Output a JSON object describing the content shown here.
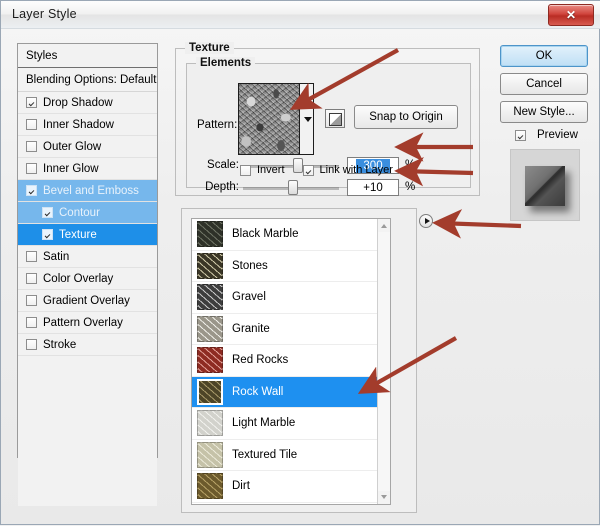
{
  "window": {
    "title": "Layer Style",
    "close_label": "✕"
  },
  "styles_panel": {
    "header": "Styles",
    "blending_options": "Blending Options: Default",
    "items": [
      {
        "label": "Drop Shadow",
        "checked": true,
        "selected": "none",
        "indent": false
      },
      {
        "label": "Inner Shadow",
        "checked": false,
        "selected": "none",
        "indent": false
      },
      {
        "label": "Outer Glow",
        "checked": false,
        "selected": "none",
        "indent": false
      },
      {
        "label": "Inner Glow",
        "checked": false,
        "selected": "none",
        "indent": false
      },
      {
        "label": "Bevel and Emboss",
        "checked": true,
        "selected": "soft",
        "indent": false
      },
      {
        "label": "Contour",
        "checked": true,
        "selected": "soft",
        "indent": true
      },
      {
        "label": "Texture",
        "checked": true,
        "selected": "strong",
        "indent": true
      },
      {
        "label": "Satin",
        "checked": false,
        "selected": "none",
        "indent": false
      },
      {
        "label": "Color Overlay",
        "checked": false,
        "selected": "none",
        "indent": false
      },
      {
        "label": "Gradient Overlay",
        "checked": false,
        "selected": "none",
        "indent": false
      },
      {
        "label": "Pattern Overlay",
        "checked": false,
        "selected": "none",
        "indent": false
      },
      {
        "label": "Stroke",
        "checked": false,
        "selected": "none",
        "indent": false
      }
    ]
  },
  "texture": {
    "group_title": "Texture",
    "elements_title": "Elements",
    "pattern_label": "Pattern:",
    "snap_to_origin_label": "Snap to Origin",
    "scale_label": "Scale:",
    "scale_value": "300",
    "scale_unit": "%",
    "scale_thumb_pct": 57,
    "depth_label": "Depth:",
    "depth_value": "+10",
    "depth_unit": "%",
    "depth_thumb_pct": 52,
    "invert_label": "Invert",
    "invert_checked": false,
    "link_with_layer_label": "Link with Layer",
    "link_with_layer_checked": true
  },
  "pattern_list": {
    "selected": "Rock Wall",
    "items": [
      {
        "label": "Black Marble",
        "color1": "#6f7465",
        "color2": "#2e3128"
      },
      {
        "label": "Stones",
        "color1": "#cfc9a8",
        "color2": "#3a3626"
      },
      {
        "label": "Gravel",
        "color1": "#c9c9c9",
        "color2": "#3d3d3d"
      },
      {
        "label": "Granite",
        "color1": "#efeee8",
        "color2": "#9a968a"
      },
      {
        "label": "Red Rocks",
        "color1": "#e4a29a",
        "color2": "#8e2b22"
      },
      {
        "label": "Rock Wall",
        "color1": "#a99a6a",
        "color2": "#4d4427"
      },
      {
        "label": "Light Marble",
        "color1": "#f2f2ee",
        "color2": "#d2d2cc"
      },
      {
        "label": "Textured Tile",
        "color1": "#ecead9",
        "color2": "#c5c2a8"
      },
      {
        "label": "Dirt",
        "color1": "#b7a267",
        "color2": "#6c5a2c"
      }
    ]
  },
  "actions": {
    "ok": "OK",
    "cancel": "Cancel",
    "new_style": "New Style...",
    "preview_label": "Preview",
    "preview_checked": true
  },
  "colors": {
    "accent_selection": "#1e90f0",
    "accent_selection_soft": "#76b7ec",
    "annotation_arrow": "#a33c2c",
    "close_button": "#c0392b",
    "field_selection": "#3a8ede"
  }
}
